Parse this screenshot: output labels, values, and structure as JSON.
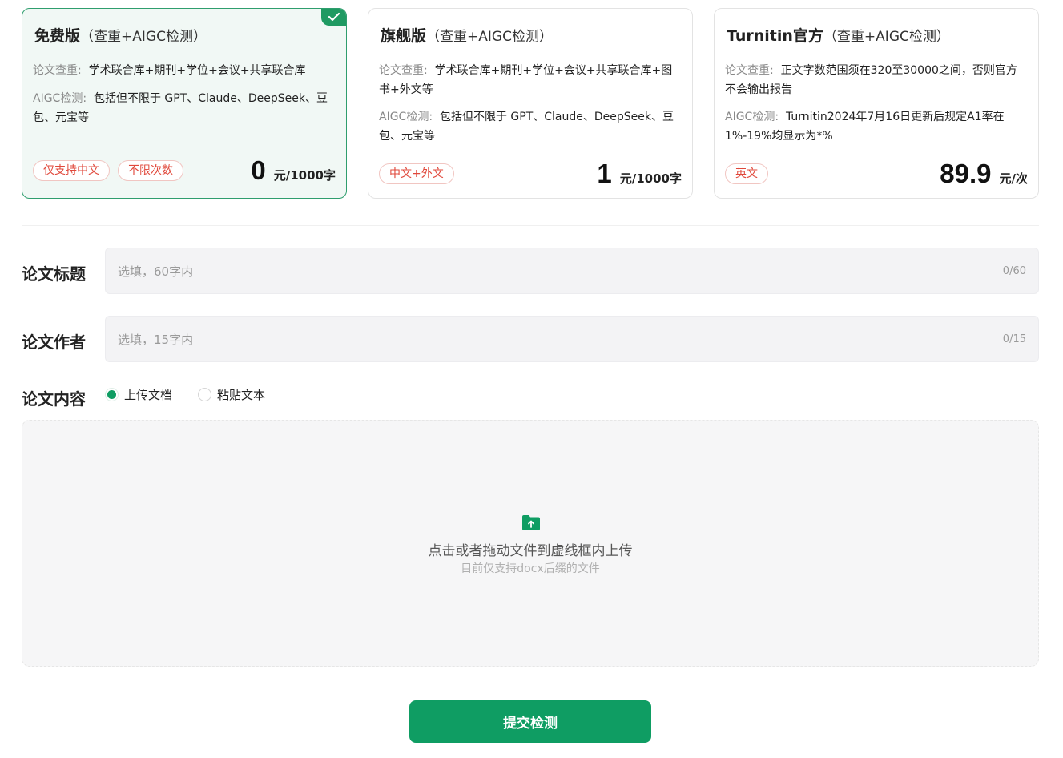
{
  "plans": [
    {
      "name": "免费版",
      "subtitle": "（查重+AIGC检测）",
      "check_label": "论文查重:",
      "check_text": "学术联合库+期刊+学位+会议+共享联合库",
      "aigc_label": "AIGC检测:",
      "aigc_text": "包括但不限于 GPT、Claude、DeepSeek、豆包、元宝等",
      "tags": [
        "仅支持中文",
        "不限次数"
      ],
      "price": "0",
      "unit": "元/1000字",
      "selected": true
    },
    {
      "name": "旗舰版",
      "subtitle": "（查重+AIGC检测）",
      "check_label": "论文查重:",
      "check_text": "学术联合库+期刊+学位+会议+共享联合库+图书+外文等",
      "aigc_label": "AIGC检测:",
      "aigc_text": "包括但不限于 GPT、Claude、DeepSeek、豆包、元宝等",
      "tags": [
        "中文+外文"
      ],
      "price": "1",
      "unit": "元/1000字",
      "selected": false
    },
    {
      "name": "Turnitin官方",
      "subtitle": "（查重+AIGC检测）",
      "check_label": "论文查重:",
      "check_text": "正文字数范围须在320至30000之间，否则官方不会输出报告",
      "aigc_label": "AIGC检测:",
      "aigc_text": "Turnitin2024年7月16日更新后规定A1率在1%-19%均显示为*%",
      "tags": [
        "英文"
      ],
      "price": "89.9",
      "unit": "元/次",
      "selected": false
    }
  ],
  "form": {
    "title_label": "论文标题",
    "title_placeholder": "选填，60字内",
    "title_count": "0/60",
    "author_label": "论文作者",
    "author_placeholder": "选填，15字内",
    "author_count": "0/15",
    "content_label": "论文内容",
    "content_options": [
      {
        "label": "上传文档",
        "checked": true
      },
      {
        "label": "粘贴文本",
        "checked": false
      }
    ]
  },
  "upload": {
    "icon": "folder-upload-icon",
    "main_text": "点击或者拖动文件到虚线框内上传",
    "sub_text": "目前仅支持docx后缀的文件"
  },
  "submit_label": "提交检测",
  "colors": {
    "accent": "#0f9d63",
    "selected_border": "#2f9e6e",
    "tag_red": "#e0483b",
    "input_bg": "#f3f3f5"
  }
}
